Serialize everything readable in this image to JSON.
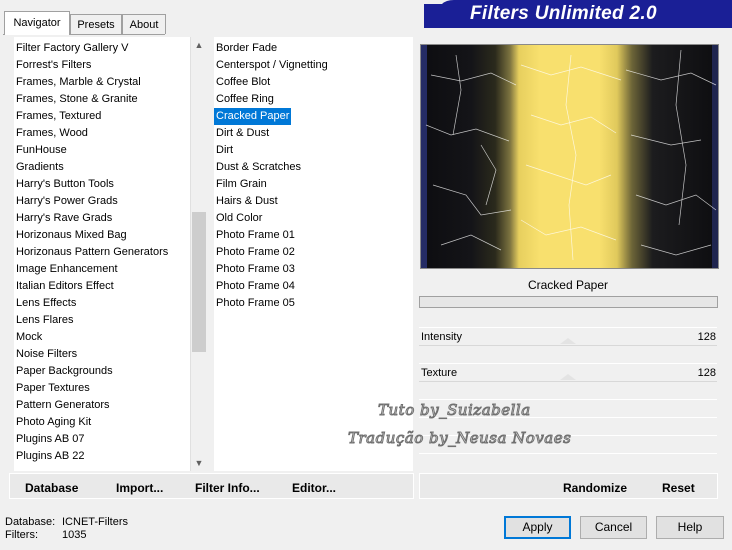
{
  "tabs": [
    {
      "label": "Navigator",
      "active": true
    },
    {
      "label": "Presets",
      "active": false
    },
    {
      "label": "About",
      "active": false
    }
  ],
  "title": "Filters Unlimited 2.0",
  "categories": [
    "Filter Factory Gallery V",
    "Forrest's Filters",
    "Frames, Marble & Crystal",
    "Frames, Stone & Granite",
    "Frames, Textured",
    "Frames, Wood",
    "FunHouse",
    "Gradients",
    "Harry's Button Tools",
    "Harry's Power Grads",
    "Harry's Rave Grads",
    "Horizonaus Mixed Bag",
    "Horizonaus Pattern Generators",
    "Image Enhancement",
    "Italian Editors Effect",
    "Lens Effects",
    "Lens Flares",
    "Mock",
    "Noise Filters",
    "Paper Backgrounds",
    "Paper Textures",
    "Pattern Generators",
    "Photo Aging Kit",
    "Plugins AB 07",
    "Plugins AB 22"
  ],
  "filters": [
    "Border Fade",
    "Centerspot / Vignetting",
    "Coffee Blot",
    "Coffee Ring",
    "Cracked Paper",
    "Dirt & Dust",
    "Dirt",
    "Dust & Scratches",
    "Film Grain",
    "Hairs & Dust",
    "Old Color",
    "Photo Frame 01",
    "Photo Frame 02",
    "Photo Frame 03",
    "Photo Frame 04",
    "Photo Frame 05"
  ],
  "selected_filter": "Cracked Paper",
  "preview": {
    "filter_name": "Cracked Paper",
    "colors": {
      "dark": "#111111",
      "yellow": "#f7e06a",
      "blue_edge": "#2a3570"
    }
  },
  "sliders": [
    {
      "label": "Intensity",
      "value": "128"
    },
    {
      "label": "Texture",
      "value": "128"
    }
  ],
  "left_bar": {
    "database": "Database",
    "import": "Import...",
    "filter_info": "Filter Info...",
    "editor": "Editor..."
  },
  "right_bar": {
    "randomize": "Randomize",
    "reset": "Reset"
  },
  "watermark": {
    "line1": "Tuto by_Suizabella",
    "line2": "Tradução by_Neusa Novaes"
  },
  "status": {
    "database_label": "Database:",
    "database_value": "ICNET-Filters",
    "filters_label": "Filters:",
    "filters_value": "1035"
  },
  "buttons": {
    "apply": "Apply",
    "cancel": "Cancel",
    "help": "Help"
  },
  "icons": {
    "scroll_up": "chevron-up-icon",
    "scroll_down": "chevron-down-icon"
  }
}
